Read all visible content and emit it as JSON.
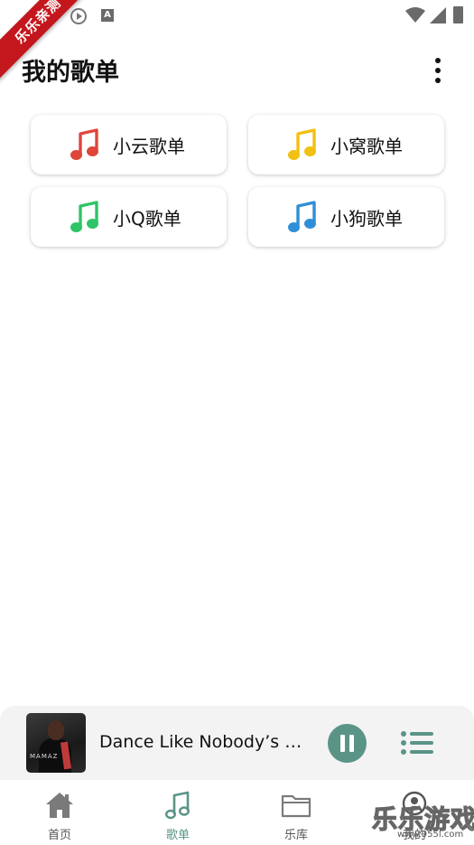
{
  "watermark": {
    "ribbon_text": "乐乐亲测",
    "brand_text": "乐乐游戏",
    "brand_url": "www.955l.com"
  },
  "status_bar": {
    "icons": [
      "play-circle-icon",
      "a-badge-icon",
      "wifi-icon",
      "signal-icon",
      "battery-icon"
    ],
    "a_badge_letter": "A"
  },
  "header": {
    "title": "我的歌单",
    "more_icon": "more-vertical-icon"
  },
  "playlists": [
    {
      "label": "小云歌单",
      "icon": "music-note-icon",
      "color": "#e0453a"
    },
    {
      "label": "小窝歌单",
      "icon": "music-note-icon",
      "color": "#f2c010"
    },
    {
      "label": "小Q歌单",
      "icon": "music-note-icon",
      "color": "#2ec467"
    },
    {
      "label": "小狗歌单",
      "icon": "music-note-icon",
      "color": "#2f8fd6"
    }
  ],
  "player": {
    "song_title": "Dance Like Nobody’s Wa...",
    "album_art_label": "MAMAZ",
    "play_state": "playing",
    "pause_icon": "pause-icon",
    "queue_icon": "playlist-queue-icon",
    "accent_color": "#5a9487"
  },
  "bottom_nav": {
    "items": [
      {
        "label": "首页",
        "icon": "home-icon",
        "active": false
      },
      {
        "label": "歌单",
        "icon": "music-note-icon",
        "active": true
      },
      {
        "label": "乐库",
        "icon": "folder-icon",
        "active": false
      },
      {
        "label": "我的",
        "icon": "user-icon",
        "active": false
      }
    ]
  }
}
